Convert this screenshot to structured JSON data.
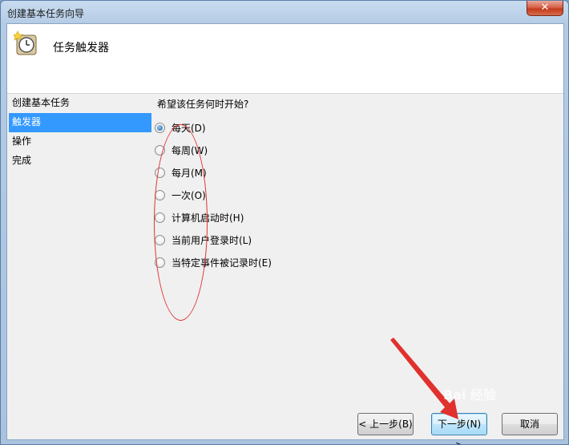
{
  "window": {
    "title": "创建基本任务向导",
    "close_label": "✕"
  },
  "header": {
    "title": "任务触发器",
    "icon": "task-clock-icon"
  },
  "steps": [
    {
      "label": "创建基本任务",
      "active": false
    },
    {
      "label": "触发器",
      "active": true
    },
    {
      "label": "操作",
      "active": false
    },
    {
      "label": "完成",
      "active": false
    }
  ],
  "question": "希望该任务何时开始?",
  "options": [
    {
      "label": "每天(D)",
      "checked": true
    },
    {
      "label": "每周(W)",
      "checked": false
    },
    {
      "label": "每月(M)",
      "checked": false
    },
    {
      "label": "一次(O)",
      "checked": false
    },
    {
      "label": "计算机启动时(H)",
      "checked": false
    },
    {
      "label": "当前用户登录时(L)",
      "checked": false
    },
    {
      "label": "当特定事件被记录时(E)",
      "checked": false
    }
  ],
  "buttons": {
    "back": "< 上一步(B)",
    "next": "下一步(N) >",
    "cancel": "取消"
  },
  "watermark": "Bai 经验",
  "colors": {
    "selection": "#3399ff",
    "annotation": "#e0312e"
  }
}
